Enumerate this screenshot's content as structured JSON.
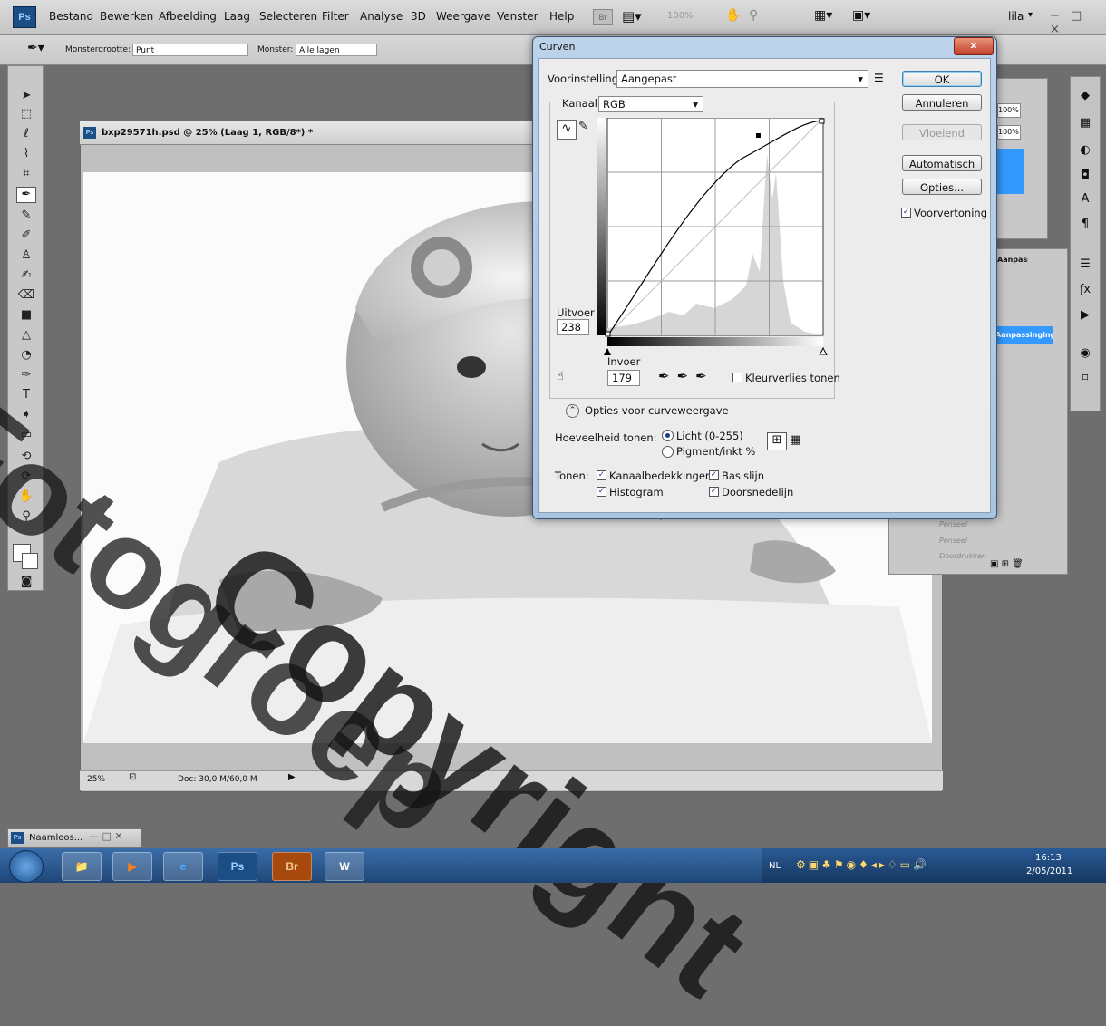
{
  "menu": {
    "logo": "Ps",
    "items": [
      "Bestand",
      "Bewerken",
      "Afbeelding",
      "Laag",
      "Selecteren",
      "Filter",
      "Analyse",
      "3D",
      "Weergave",
      "Venster",
      "Help"
    ],
    "bridge_btn": "Br",
    "zoom": "100%",
    "workspace": "lila",
    "win_controls": "− □ ×"
  },
  "options_bar": {
    "sample_size_label": "Monstergrootte:",
    "sample_size_value": "Punt",
    "sample_label": "Monster:",
    "sample_value": "Alle lagen"
  },
  "document": {
    "title": "bxp29571h.psd @ 25% (Laag 1, RGB/8*) *",
    "zoom": "25%",
    "doc_info": "Doc: 30,0 M/60,0 M"
  },
  "panels": {
    "percent_a": "100%",
    "percent_b": "100%",
    "panel_tab": "Aanpassingen",
    "layer_items": [
      "Penseel",
      "Penseel",
      "Doordrukken"
    ],
    "selected_item": "Aanpassinging"
  },
  "dialog": {
    "title": "Curven",
    "close": "x",
    "preset_label": "Voorinstelling:",
    "preset_value": "Aangepast",
    "channel_label": "Kanaal:",
    "channel_value": "RGB",
    "output_label": "Uitvoer",
    "output_value": "238",
    "input_label": "Invoer",
    "input_value": "179",
    "clipping_label": "Kleurverlies tonen",
    "clipping_checked": false,
    "ok": "OK",
    "cancel": "Annuleren",
    "smooth": "Vloeiend",
    "auto": "Automatisch",
    "options": "Opties...",
    "preview_label": "Voorvertoning",
    "preview_checked": true,
    "curve_options_label": "Opties voor curveweergave",
    "show_amount_label": "Hoeveelheid tonen:",
    "light_label": "Licht (0-255)",
    "pigment_label": "Pigment/inkt %",
    "show_label": "Tonen:",
    "show_options": [
      {
        "label": "Kanaalbedekkingen",
        "checked": true
      },
      {
        "label": "Basislijn",
        "checked": true
      },
      {
        "label": "Histogram",
        "checked": true
      },
      {
        "label": "Doorsnedelijn",
        "checked": true
      }
    ]
  },
  "minimized": {
    "title": "Naamloos..."
  },
  "taskbar": {
    "apps": [
      "Ps",
      "Br"
    ],
    "lang": "NL",
    "time": "16:13",
    "date": "2/05/2011"
  },
  "watermark": {
    "text": "Copyright",
    "text2": "Fotogroep"
  },
  "colors": {
    "accent": "#3399ff",
    "dialog_frame": "#a9c4e0",
    "taskbar": "#1f4677"
  }
}
